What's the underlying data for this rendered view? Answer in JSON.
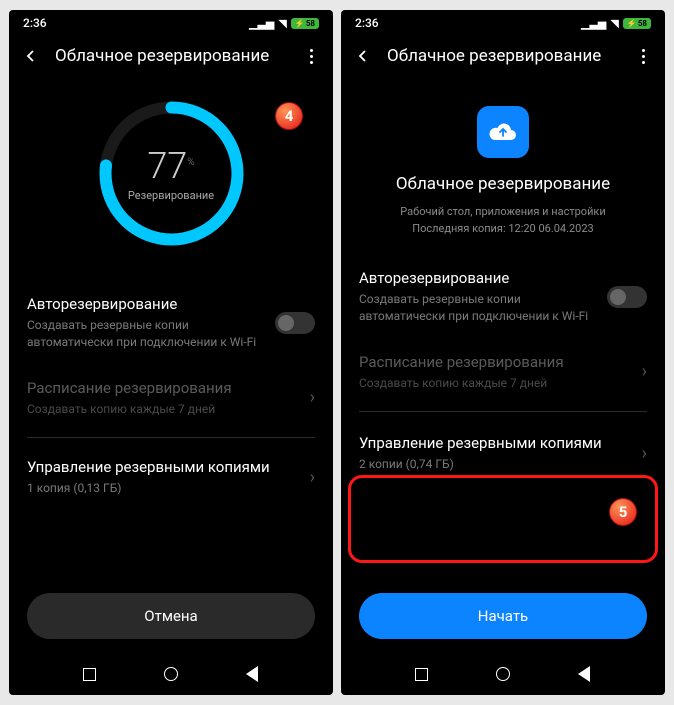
{
  "status": {
    "time": "2:36",
    "battery": "58"
  },
  "header": {
    "title": "Облачное резервирование"
  },
  "progress": {
    "percent": "77",
    "symbol": "%",
    "label": "Резервирование"
  },
  "cloud": {
    "title": "Облачное резервирование",
    "sub1": "Рабочий стол, приложения и настройки",
    "sub2": "Последняя копия: 12:20 06.04.2023"
  },
  "auto": {
    "title": "Авторезервирование",
    "desc1": "Создавать резервные копии автоматически при подключении к Wi-Fi",
    "desc2": "Создавать резервные копии автоматически при подключении к Wi-Fi"
  },
  "schedule": {
    "title": "Расписание резервирования",
    "desc": "Создавать копию каждые 7 дней"
  },
  "manage": {
    "title": "Управление резервными копиями",
    "desc1": "1 копия (0,13 ГБ)",
    "desc2": "2 копии (0,74 ГБ)"
  },
  "buttons": {
    "cancel": "Отмена",
    "start": "Начать"
  },
  "annotations": {
    "a4": "4",
    "a5": "5"
  }
}
